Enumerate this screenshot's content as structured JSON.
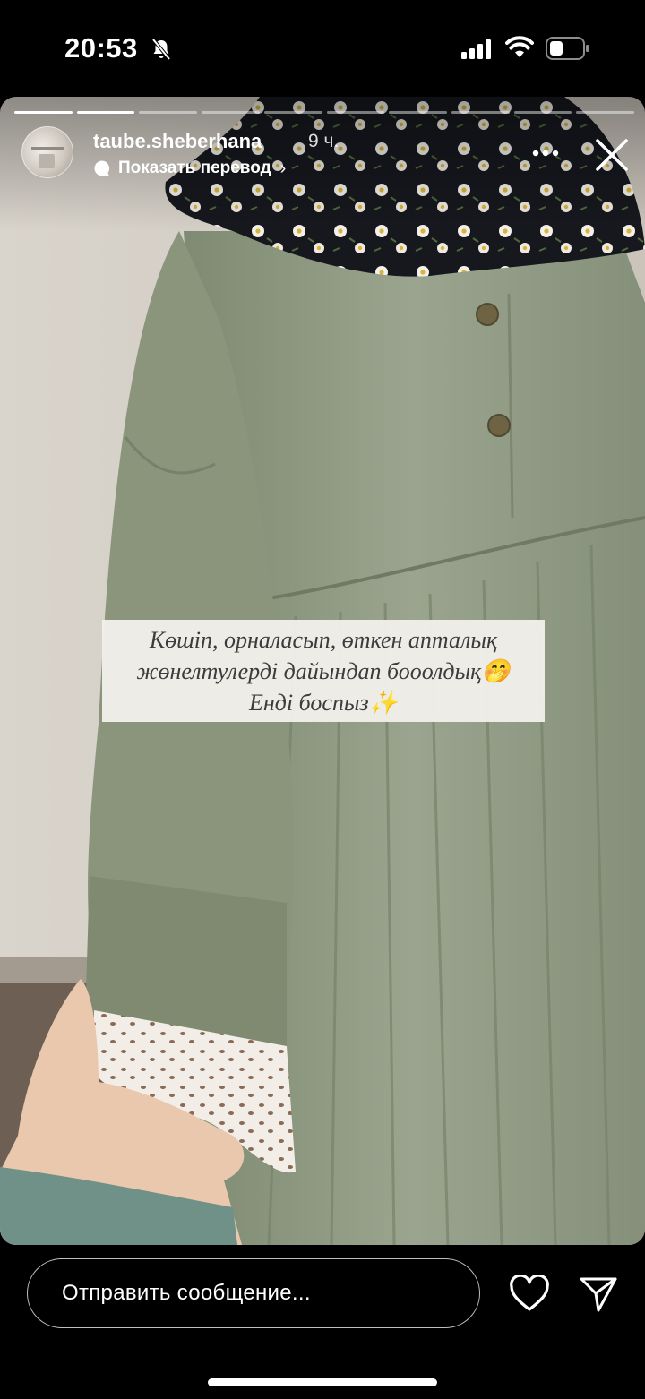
{
  "status_bar": {
    "time": "20:53",
    "icons": [
      "bell-slash-icon",
      "signal-icon",
      "wifi-icon",
      "battery-icon"
    ]
  },
  "story": {
    "progress": {
      "total_segments": 10,
      "current_segment": 2
    },
    "header": {
      "username": "taube.sheberhana",
      "time_ago": "9 ч.",
      "translate_label": "Показать перевод"
    },
    "caption": {
      "lines": [
        "Көшіп, орналасып, өткен апталық",
        "жөнелтулерді дайындап бооолдық🤭",
        "Енді боспыз✨"
      ]
    }
  },
  "bottom_bar": {
    "message_placeholder": "Отправить сообщение...",
    "icons": [
      "heart-icon",
      "send-icon"
    ]
  },
  "colors": {
    "background": "#000000",
    "dress": "#8f9a82",
    "scarf": "#1a1c22",
    "wall": "#d6d1c9"
  }
}
